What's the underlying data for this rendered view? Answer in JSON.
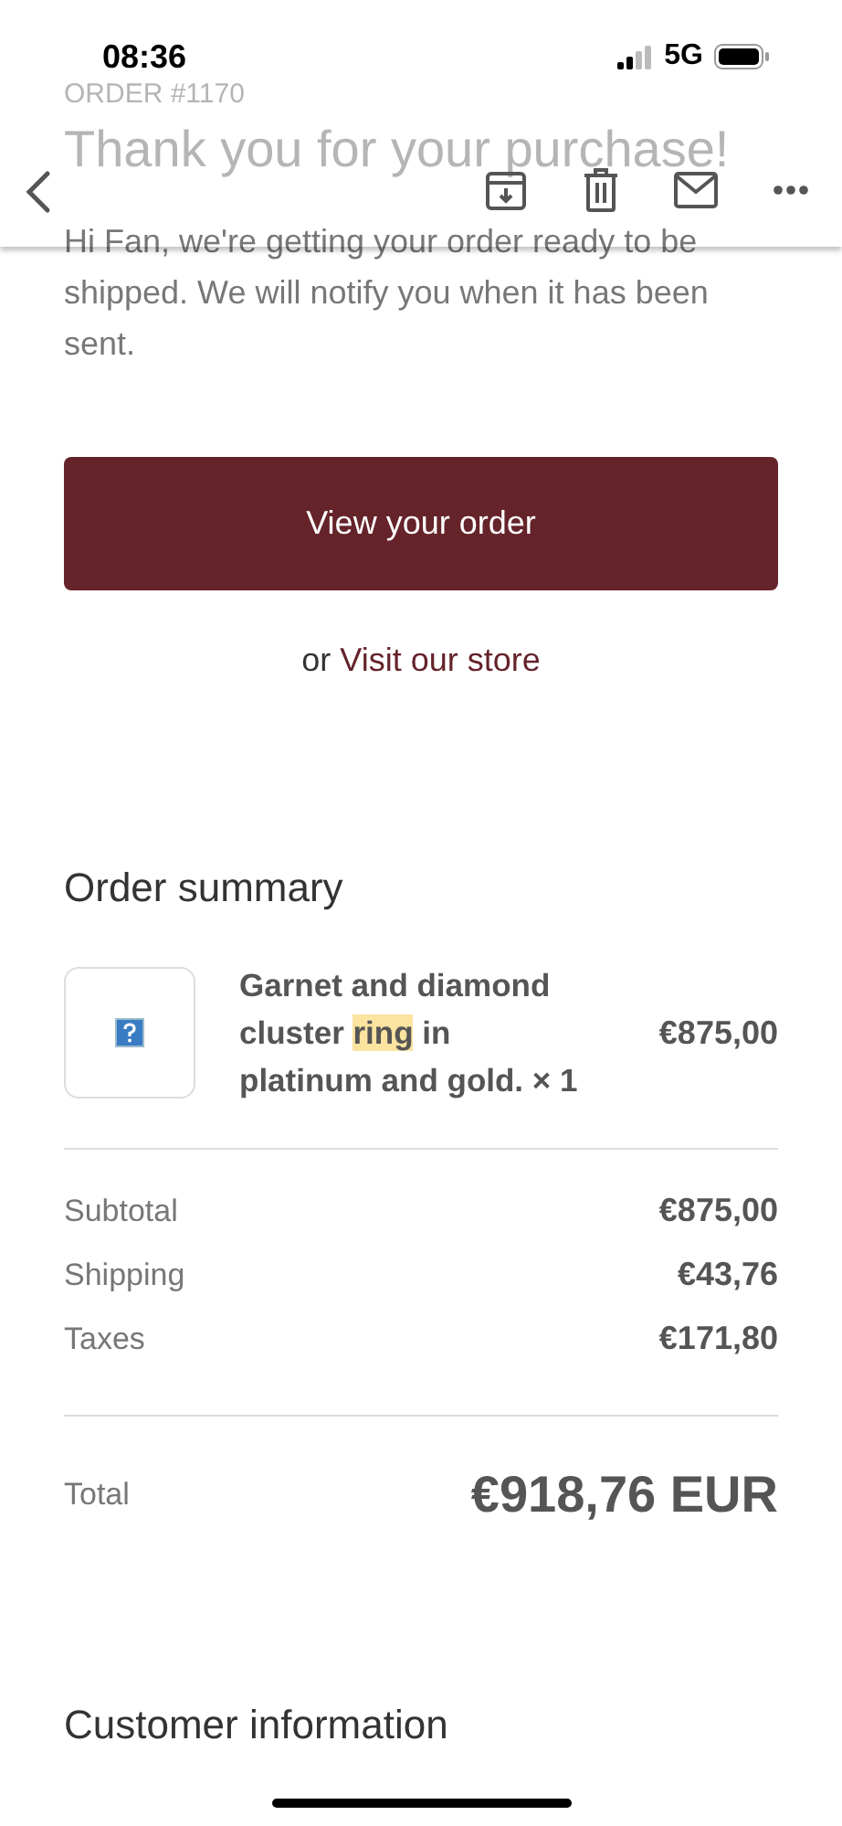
{
  "status_bar": {
    "time": "08:36",
    "network": "5G"
  },
  "email": {
    "order_label": "ORDER #1170",
    "heading": "Thank you for your purchase!",
    "message": "Hi Fan, we're getting your order ready to be shipped. We will notify you when it has been sent.",
    "primary_button": "View your order",
    "alt_prefix": "or",
    "alt_link": "Visit our store"
  },
  "toolbar": {
    "actions": [
      {
        "kind": "archive"
      },
      {
        "kind": "delete"
      },
      {
        "kind": "mail"
      },
      {
        "kind": "more"
      }
    ]
  },
  "order_summary": {
    "title": "Order summary",
    "items": [
      {
        "name_parts": [
          {
            "text": "Garnet and diamond cluster ",
            "highlighted": false
          },
          {
            "text": "ring",
            "highlighted": true
          },
          {
            "text": " in platinum and gold. × 1",
            "highlighted": false
          }
        ],
        "price": "€875,00"
      }
    ],
    "lines": [
      {
        "label": "Subtotal",
        "value": "€875,00"
      },
      {
        "label": "Shipping",
        "value": "€43,76"
      },
      {
        "label": "Taxes",
        "value": "€171,80"
      }
    ],
    "total": {
      "label": "Total",
      "value": "€918,76 EUR"
    }
  },
  "customer_section": {
    "title": "Customer information"
  }
}
